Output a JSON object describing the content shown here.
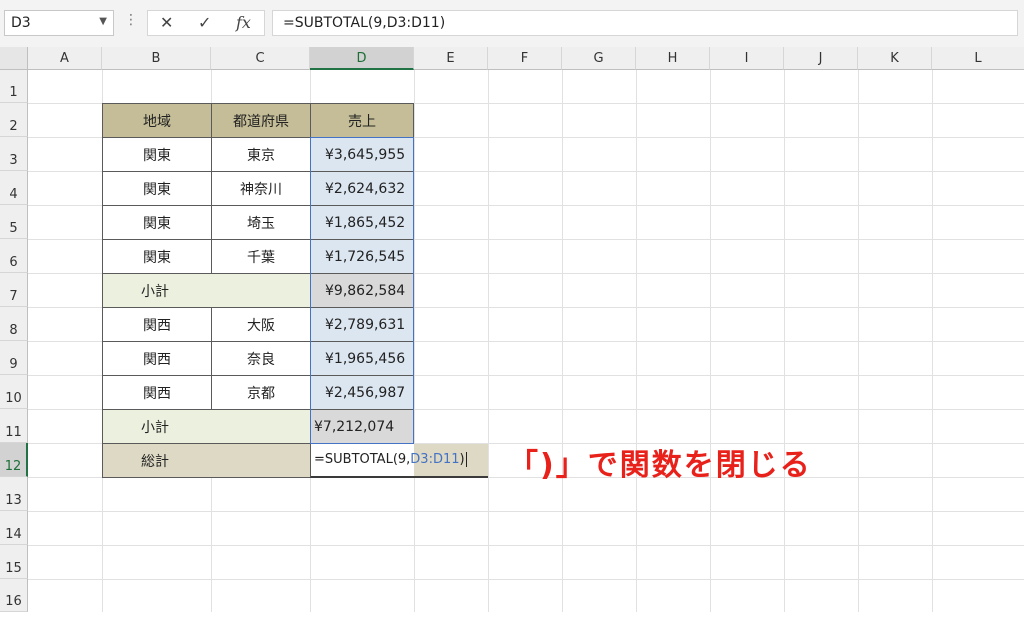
{
  "formula_bar": {
    "name_box": "D3",
    "name_box_dropdown_icon": "chevron-down-icon",
    "more_icon": "vertical-dots-icon",
    "cancel_glyph": "✕",
    "enter_glyph": "✓",
    "fx_glyph": "fx",
    "formula_text": "=SUBTOTAL(9,D3:D11)"
  },
  "columns": [
    "A",
    "B",
    "C",
    "D",
    "E",
    "F",
    "G",
    "H",
    "I",
    "J",
    "K",
    "L"
  ],
  "rows": [
    "1",
    "2",
    "3",
    "4",
    "5",
    "6",
    "7",
    "8",
    "9",
    "10",
    "11",
    "12",
    "13",
    "14",
    "15",
    "16"
  ],
  "table": {
    "header": {
      "region": "地域",
      "prefecture": "都道府県",
      "sales": "売上"
    },
    "rows": [
      {
        "region": "関東",
        "prefecture": "東京",
        "sales": "¥3,645,955"
      },
      {
        "region": "関東",
        "prefecture": "神奈川",
        "sales": "¥2,624,632"
      },
      {
        "region": "関東",
        "prefecture": "埼玉",
        "sales": "¥1,865,452"
      },
      {
        "region": "関東",
        "prefecture": "千葉",
        "sales": "¥1,726,545"
      },
      {
        "subtotal_label": "小計",
        "sales": "¥9,862,584"
      },
      {
        "region": "関西",
        "prefecture": "大阪",
        "sales": "¥2,789,631"
      },
      {
        "region": "関西",
        "prefecture": "奈良",
        "sales": "¥1,965,456"
      },
      {
        "region": "関西",
        "prefecture": "京都",
        "sales": "¥2,456,987"
      },
      {
        "subtotal_label": "小計",
        "sales": "¥7,212,074"
      }
    ],
    "total": {
      "label": "総計",
      "formula_prefix": "=SUBTOTAL(9,",
      "formula_ref": "D3:D11",
      "formula_suffix": ")"
    }
  },
  "annotation": "「)」で関数を閉じる",
  "colors": {
    "header_fill": "#c4bd97",
    "subtotal_fill": "#ebf1de",
    "sales_fill": "#dce6f1",
    "subtotal_sales_fill": "#d9d9d9",
    "total_fill": "#ddd9c4",
    "ref_blue": "#4472c4",
    "annotation_red": "#e8211b"
  }
}
